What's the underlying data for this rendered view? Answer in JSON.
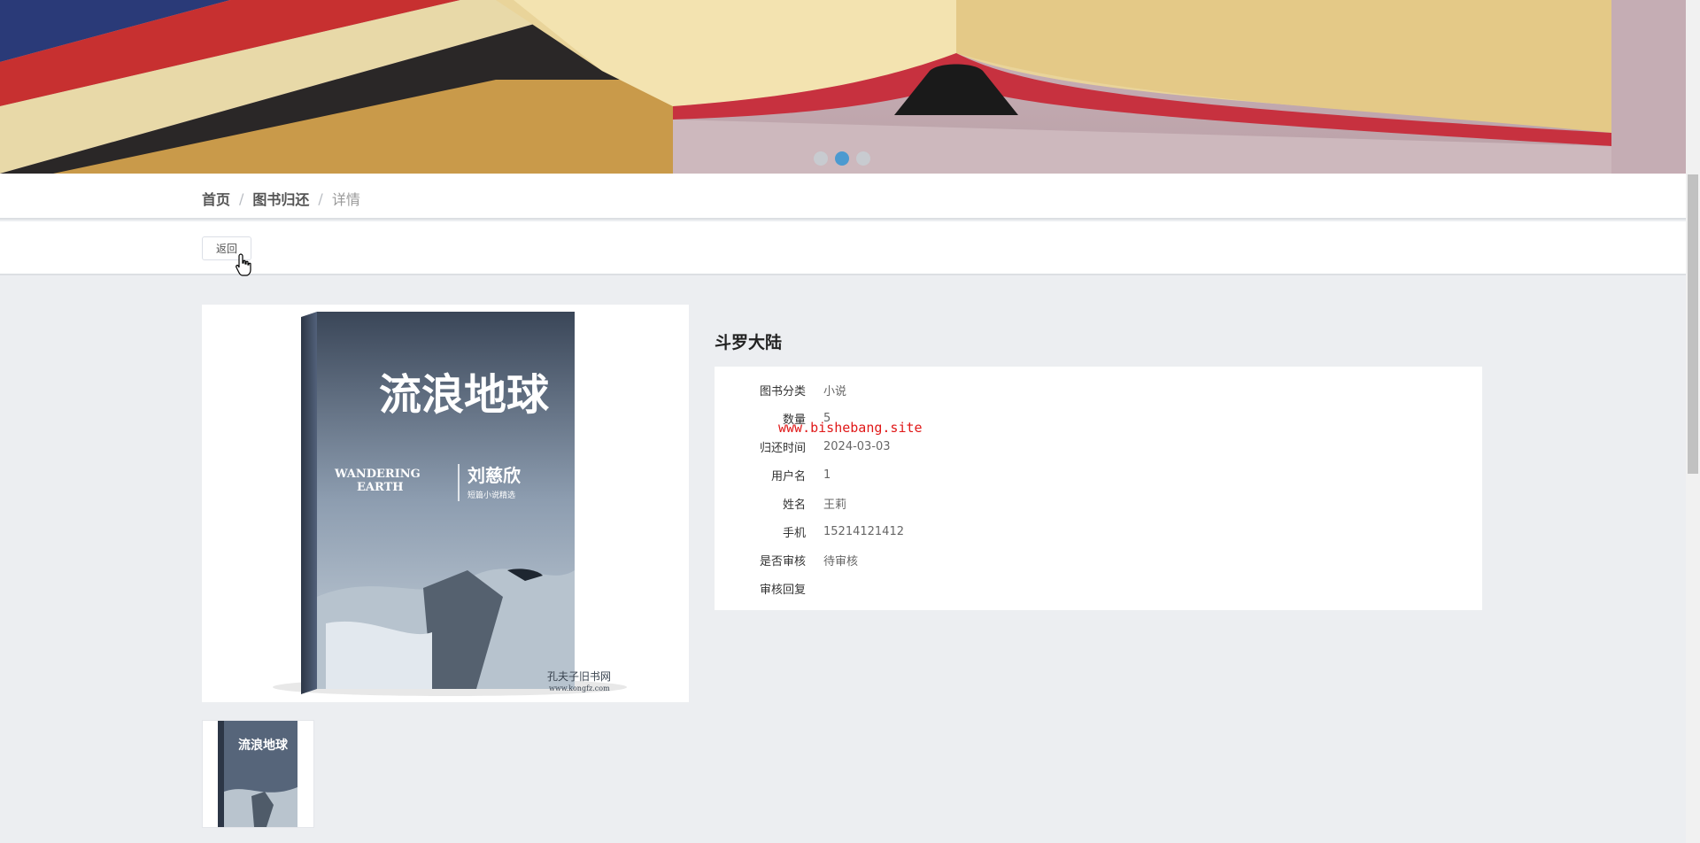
{
  "banner": {
    "dots": [
      {
        "active": false
      },
      {
        "active": true
      },
      {
        "active": false
      }
    ]
  },
  "breadcrumb": {
    "home": "首页",
    "section": "图书归还",
    "current": "详情",
    "separator": "/"
  },
  "actions": {
    "back_label": "返回"
  },
  "detail": {
    "title": "斗罗大陆",
    "fields": [
      {
        "label": "图书分类",
        "value": "小说"
      },
      {
        "label": "数量",
        "value": "5"
      },
      {
        "label": "归还时间",
        "value": "2024-03-03"
      },
      {
        "label": "用户名",
        "value": "1"
      },
      {
        "label": "姓名",
        "value": "王莉"
      },
      {
        "label": "手机",
        "value": "15214121412"
      },
      {
        "label": "是否审核",
        "value": "待审核"
      },
      {
        "label": "审核回复",
        "value": ""
      }
    ]
  },
  "cover": {
    "title_cn": "流浪地球",
    "title_en_1": "WANDERING",
    "title_en_2": "EARTH",
    "author": "刘慈欣",
    "subtitle": "短篇小说精选",
    "publisher_mark": "孔夫子旧书网",
    "site_mark": "www.kongfz.com"
  },
  "watermark": "www.bishebang.site",
  "colors": {
    "page_bg": "#eceef1",
    "accent_dot": "#4c9ad0",
    "watermark": "#e01818"
  }
}
